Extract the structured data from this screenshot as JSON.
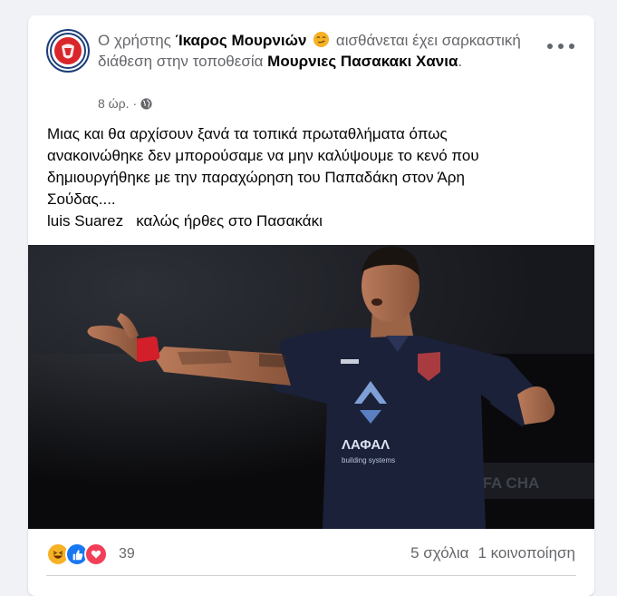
{
  "post": {
    "header": {
      "prefix": "Ο χρήστης",
      "author": "Ίκαρος Μουρνιών",
      "feeling": "αισθάνεται έχει σαρκαστική διάθεση στην τοποθεσία",
      "location": "Μουρνιες Πασακακι Χανια",
      "suffix": "."
    },
    "timestamp": "8 ώρ.",
    "dot": "·",
    "privacy_icon": "globe-icon",
    "text_lines": [
      "Μιας και θα αρχίσουν ξανά τα τοπικά πρωταθλήματα όπως",
      "ανακοινώθηκε δεν μπορούσαμε να μην καλύψουμε το κενό που",
      "δημιουργήθηκε με την παραχώρηση του Παπαδάκη στον Άρη",
      "Σούδας....",
      "luis Suarez   καλώς ήρθες στο Πασακάκι"
    ],
    "photo": {
      "jersey_text": "ΛΑΦΑΛ",
      "jersey_subtext": "building systems",
      "background_text": "UEFA CHA"
    },
    "reactions": {
      "icons": [
        "haha-icon",
        "like-icon",
        "love-icon"
      ],
      "count": "39"
    },
    "comments": "5 σχόλια",
    "shares": "1 κοινοποίηση"
  },
  "colors": {
    "page_bg": "#f0f2f5",
    "card_bg": "#ffffff",
    "secondary_text": "#65676b",
    "like_blue": "#1877f2",
    "love_red": "#f33e58",
    "haha_yellow": "#f7b125"
  }
}
